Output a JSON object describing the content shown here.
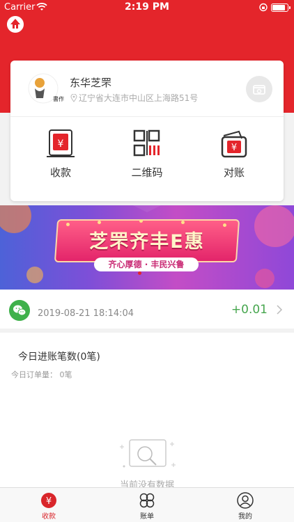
{
  "status_bar": {
    "carrier": "Carrier",
    "time": "2:19 PM"
  },
  "merchant": {
    "name": "东华芝罘",
    "address": "辽宁省大连市中山区上海路51号",
    "avatar_label": "書作"
  },
  "actions": [
    {
      "label": "收款",
      "icon": "payment-receipt-icon"
    },
    {
      "label": "二维码",
      "icon": "qr-code-icon"
    },
    {
      "label": "对账",
      "icon": "reconcile-icon"
    }
  ],
  "banner": {
    "title": "芝罘齐丰E惠",
    "subtitle": "齐心厚德 · 丰民兴鲁"
  },
  "transaction": {
    "datetime": "2019-08-21 18:14:04",
    "amount": "+0.01",
    "method_icon": "wechat-icon"
  },
  "stats": {
    "title": "今日进账笔数(0笔)",
    "orders": "今日订单量： 0笔",
    "empty_text": "当前没有数据"
  },
  "tabbar": [
    {
      "label": "收款",
      "icon": "yuan-icon",
      "active": true
    },
    {
      "label": "账单",
      "icon": "clover-icon",
      "active": false
    },
    {
      "label": "我的",
      "icon": "user-icon",
      "active": false
    }
  ],
  "colors": {
    "brand_red": "#e4252b",
    "accent_green": "#46a64e",
    "tab_active": "#d9262b"
  }
}
